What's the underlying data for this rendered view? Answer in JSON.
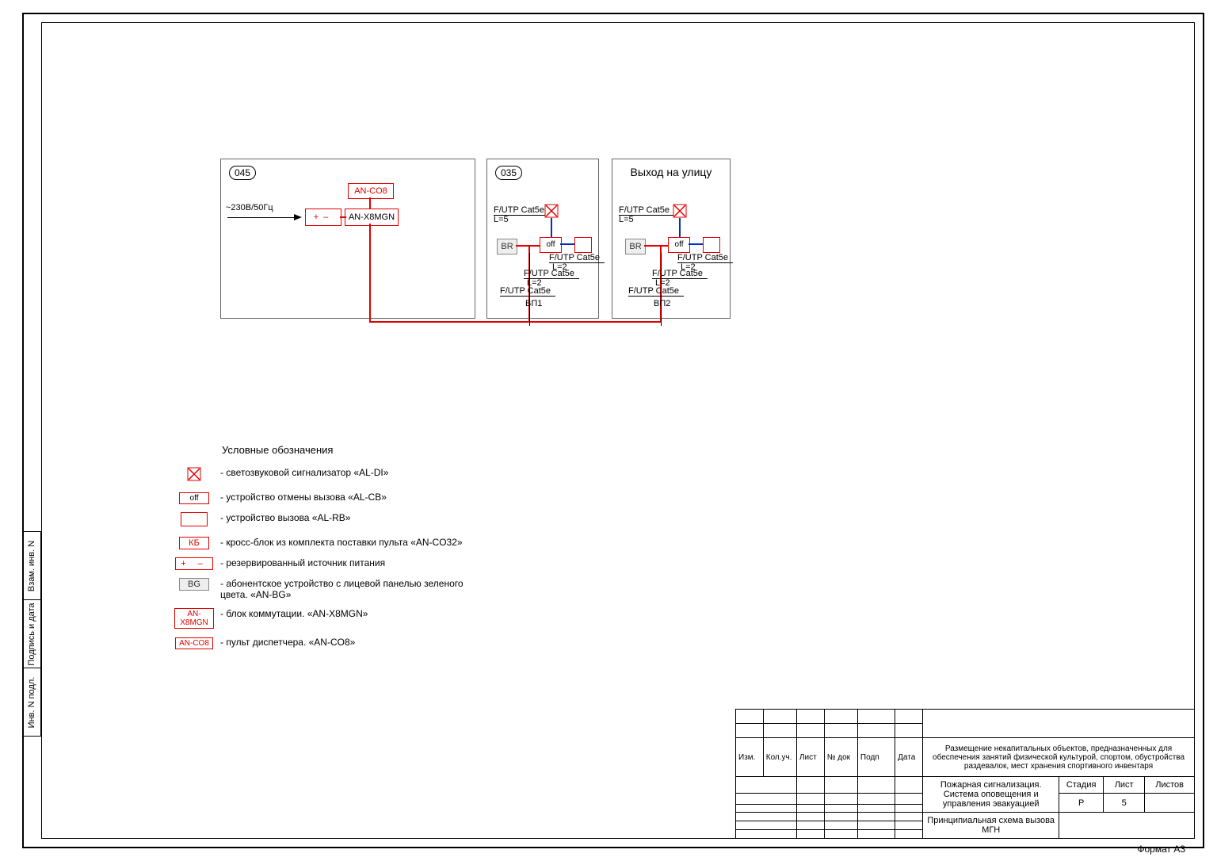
{
  "rooms": {
    "r045": "045",
    "r035": "035",
    "rExit": "Выход на улицу"
  },
  "power": "~230В/50Гц",
  "devices": {
    "an_co8": "AN-CO8",
    "an_x8mgn": "AN-X8MGN",
    "br": "BR",
    "off": "off",
    "plus": "+",
    "minus": "–"
  },
  "cables": {
    "futp": "F/UTP Cat5e",
    "l5": "L=5",
    "l2": "L=2",
    "bp1": "ВП1",
    "bp2": "ВП2"
  },
  "legend": {
    "title": "Условные обозначения",
    "items": [
      {
        "sym": "signal",
        "text": "- светозвуковой сигнализатор «AL-DI»"
      },
      {
        "sym": "off",
        "text": "- устройство отмены вызова «AL-CB»"
      },
      {
        "sym": "call",
        "text": "- устройство вызова «AL-RB»"
      },
      {
        "sym": "kb",
        "text": "- кросс-блок из комплекта поставки пульта «AN-CO32»",
        "label": "КБ"
      },
      {
        "sym": "pm",
        "text": "- резервированный источник питания"
      },
      {
        "sym": "bg",
        "text": "- абонентское устройство с лицевой панелью зеленого цвета. «AN-BG»",
        "label": "BG"
      },
      {
        "sym": "x8",
        "text": "- блок коммутации. «AN-X8MGN»",
        "label": "AN-X8MGN"
      },
      {
        "sym": "co8",
        "text": "- пульт диспетчера. «AN-CO8»",
        "label": "AN-CO8"
      }
    ]
  },
  "titleblock": {
    "headers": [
      "Изм.",
      "Кол.уч.",
      "Лист",
      "№ док",
      "Подп",
      "Дата"
    ],
    "project": "Размещение некапитальных объектов, предназначенных для обеспечения занятий физической культурой, спортом, обустройства раздевалок, мест хранения спортивного инвентаря",
    "system": "Пожарная сигнализация.\nСистема оповещения и управления эвакуацией",
    "drawing": "Принципиальная схема вызова МГН",
    "stage_h": "Стадия",
    "sheet_h": "Лист",
    "sheets_h": "Листов",
    "stage": "Р",
    "sheet": "5",
    "sheets": ""
  },
  "sidetabs": [
    "Взам. инв. N",
    "Подпись и дата",
    "Инв. N подл."
  ],
  "format": "Формат  А3"
}
